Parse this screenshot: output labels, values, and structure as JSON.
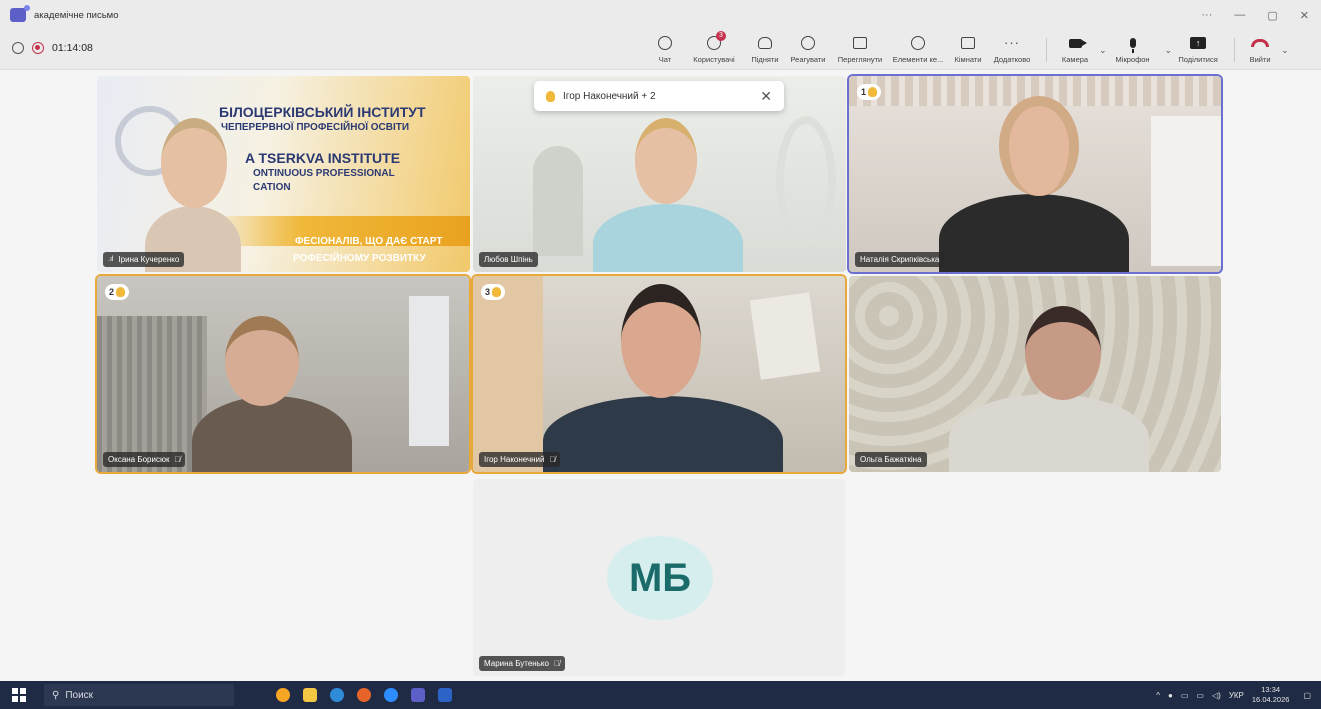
{
  "window": {
    "title": "академічне письмо"
  },
  "recording": {
    "time": "01:14:08"
  },
  "toolbar": {
    "chat": "Чат",
    "people": "Користувачі",
    "people_badge": "3",
    "raise": "Підняти",
    "react": "Реагувати",
    "view": "Переглянути",
    "elements": "Елементи ке...",
    "rooms": "Кімнати",
    "more": "Додатково",
    "camera": "Камера",
    "mic": "Мікрофон",
    "share": "Поділитися",
    "leave": "Вийти"
  },
  "hand_toast": {
    "text": "Ігор Наконечний + 2"
  },
  "slide": {
    "line1": "БІЛОЦЕРКІВСЬКИЙ ІНСТИТУТ",
    "line2": "ЧЕПЕРЕРВНОЇ ПРОФЕСІЙНОЇ ОСВІТИ",
    "line3": "A TSERKVA INSTITUTE",
    "line4": "ONTINUOUS PROFESSIONAL",
    "line5": "CATION",
    "line6": "ФЕСІОНАЛІВ, ЩО ДАЄ СТАРТ",
    "line7": "РОФЕСІЙНОМУ РОЗВИТКУ"
  },
  "tiles": [
    {
      "name": "Ірина Кучеренко"
    },
    {
      "name": "Любов Шпінь"
    },
    {
      "name": "Наталія Скрипківська",
      "hand": "1"
    },
    {
      "name": "Оксана Борисюк",
      "hand": "2"
    },
    {
      "name": "Ігор Наконечний",
      "hand": "3"
    },
    {
      "name": "Ольга Бажаткіна"
    },
    {
      "name": "Марина Бутенько",
      "initials": "МБ"
    }
  ],
  "taskbar": {
    "search": "Поиск",
    "lang": "УКР",
    "time": "13:34",
    "date": "16.04.2026"
  },
  "colors": {
    "accent": "#5b5fc7",
    "raised_hand": "#e7a93a",
    "record": "#c4314b"
  }
}
